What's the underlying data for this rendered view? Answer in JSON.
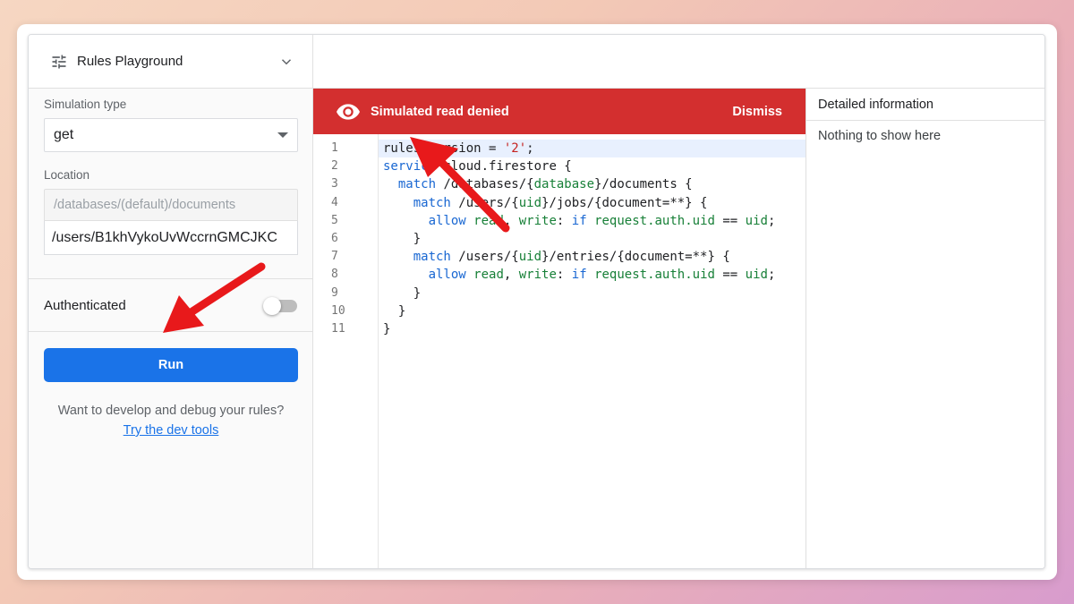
{
  "sidebar": {
    "title": "Rules Playground",
    "simulation_type_label": "Simulation type",
    "simulation_type_value": "get",
    "location_label": "Location",
    "location_prefix": "/databases/(default)/documents",
    "location_value": "/users/B1khVykoUvWccrnGMCJKC",
    "authenticated_label": "Authenticated",
    "authenticated": false,
    "run_label": "Run",
    "help_text": "Want to develop and debug your rules?",
    "help_link": "Try the dev tools"
  },
  "banner": {
    "message": "Simulated read denied",
    "dismiss_label": "Dismiss",
    "color": "#d32f2f"
  },
  "editor": {
    "line_numbers": [
      "1",
      "2",
      "3",
      "4",
      "5",
      "6",
      "7",
      "8",
      "9",
      "10",
      "11"
    ]
  },
  "detail": {
    "title": "Detailed information",
    "empty_text": "Nothing to show here"
  },
  "colors": {
    "accent": "#1a73e8",
    "error": "#d32f2f",
    "annotation_arrow": "#e8191b"
  }
}
